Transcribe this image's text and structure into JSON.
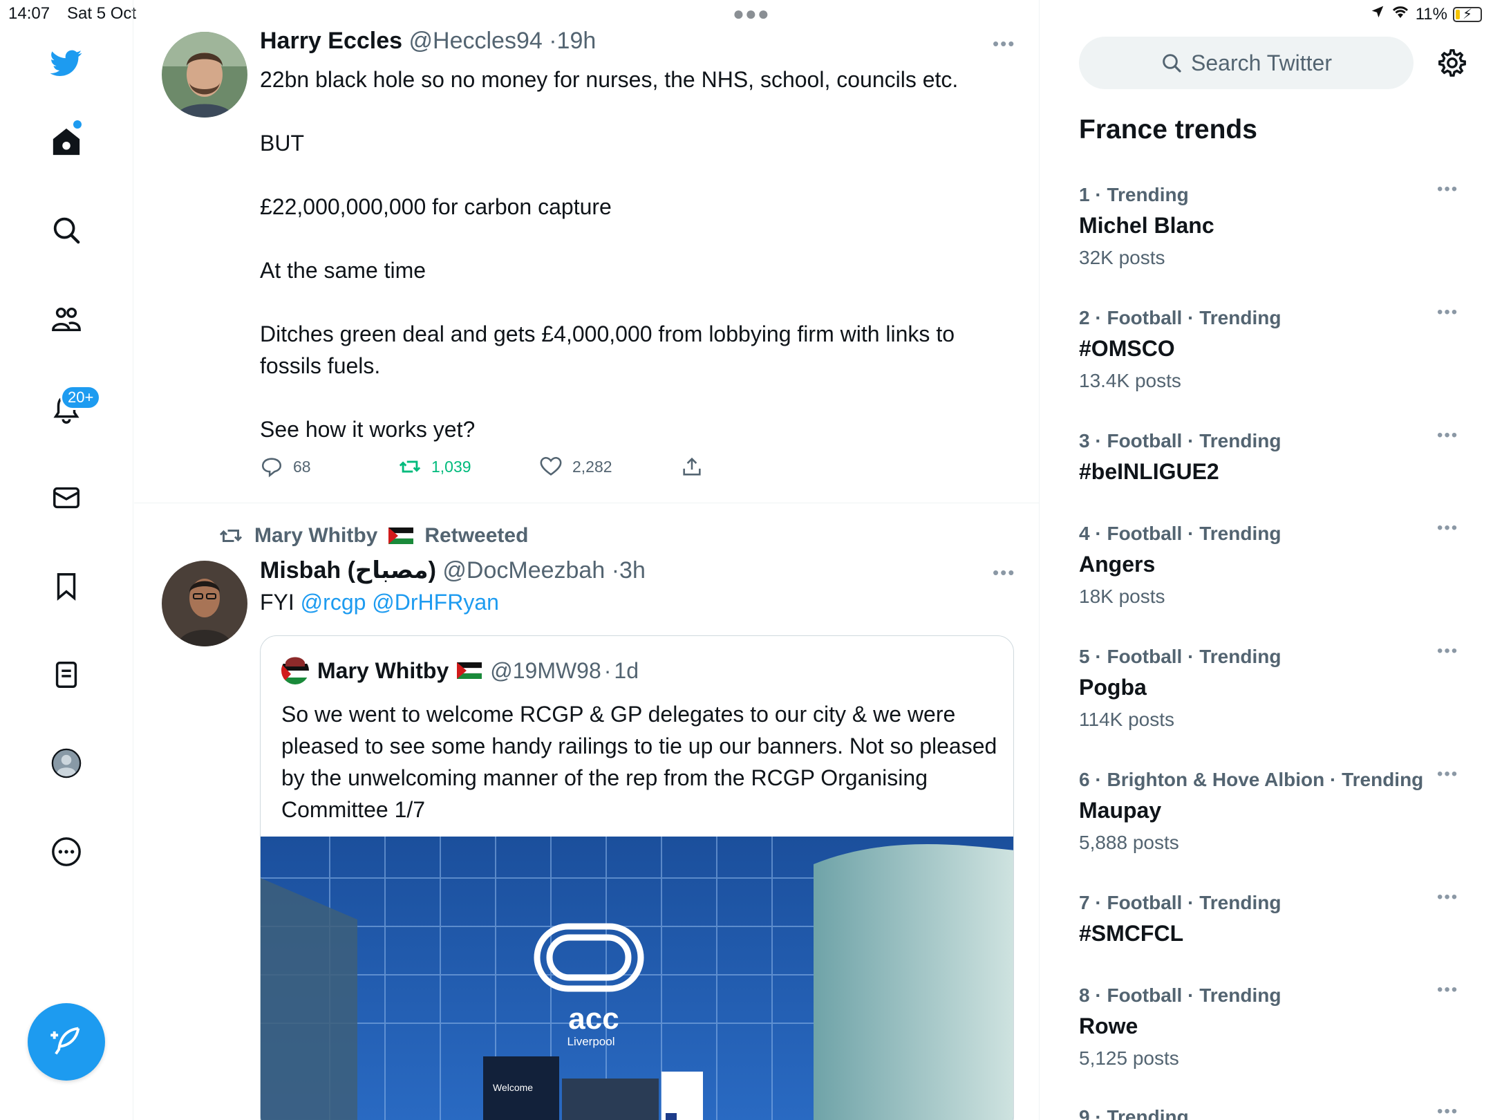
{
  "status_bar": {
    "time": "14:07",
    "date": "Sat 5 Oct",
    "battery": "11%"
  },
  "nav": {
    "notifications_badge": "20+"
  },
  "tweets": [
    {
      "name": "Harry Eccles",
      "handle": "@Heccles94",
      "time": "19h",
      "paragraphs": [
        "22bn black hole so no money for nurses, the NHS, school, councils etc.",
        "BUT",
        "£22,000,000,000 for carbon capture",
        "At the same time",
        "Ditches green deal and gets £4,000,000 from lobbying firm with links to fossils fuels.",
        "See how it works yet?"
      ],
      "replies": "68",
      "retweets": "1,039",
      "likes": "2,282"
    },
    {
      "retweeted_by": "Mary Whitby",
      "retweeted_label": "Retweeted",
      "name": "Misbah (مصباح)",
      "handle": "@DocMeezbah",
      "time": "3h",
      "text_prefix": "FYI",
      "mentions": [
        "@rcgp",
        "@DrHFRyan"
      ],
      "quote": {
        "name": "Mary Whitby",
        "handle": "@19MW98",
        "time": "1d",
        "text": "So we went to welcome RCGP & GP delegates to our city & we were pleased to see some handy railings to tie up our banners. Not so pleased by the unwelcoming manner of the rep from the RCGP Organising Committee 1/7",
        "image_sign": "acc",
        "image_sign_sub": "Liverpool",
        "image_welcome": "Welcome"
      }
    }
  ],
  "sidebar": {
    "search_placeholder": "Search Twitter",
    "trends_title": "France trends",
    "trends": [
      {
        "rank": "1",
        "context": "Trending",
        "title": "Michel Blanc",
        "count": "32K posts"
      },
      {
        "rank": "2",
        "context": "Football · Trending",
        "title": "#OMSCO",
        "count": "13.4K posts"
      },
      {
        "rank": "3",
        "context": "Football · Trending",
        "title": "#beINLIGUE2",
        "count": ""
      },
      {
        "rank": "4",
        "context": "Football · Trending",
        "title": "Angers",
        "count": "18K posts"
      },
      {
        "rank": "5",
        "context": "Football · Trending",
        "title": "Pogba",
        "count": "114K posts"
      },
      {
        "rank": "6",
        "context": "Brighton & Hove Albion · Trending",
        "title": "Maupay",
        "count": "5,888 posts"
      },
      {
        "rank": "7",
        "context": "Football · Trending",
        "title": "#SMCFCL",
        "count": ""
      },
      {
        "rank": "8",
        "context": "Football · Trending",
        "title": "Rowe",
        "count": "5,125 posts"
      },
      {
        "rank": "9",
        "context": "Trending",
        "title": "",
        "count": ""
      }
    ]
  },
  "colors": {
    "accent": "#1d9bf0",
    "retweet_green": "#00ba7c",
    "secondary_text": "#536471"
  }
}
